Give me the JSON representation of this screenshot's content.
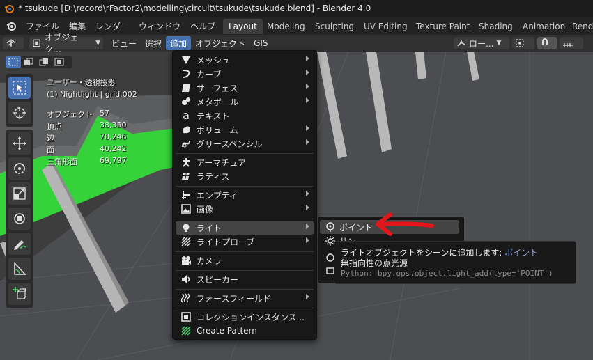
{
  "window": {
    "title": "* tsukude [D:\\record\\rFactor2\\modelling\\circuit\\tsukude\\tsukude.blend] - Blender 4.0"
  },
  "menubar": {
    "items": [
      "ファイル",
      "編集",
      "レンダー",
      "ウィンドウ",
      "ヘルプ"
    ]
  },
  "workspaces": [
    "Layout",
    "Modeling",
    "Sculpting",
    "UV Editing",
    "Texture Paint",
    "Shading",
    "Animation",
    "Rende"
  ],
  "header": {
    "mode_label": "オブジェク...",
    "menus": [
      "ビュー",
      "選択",
      "追加",
      "オブジェクト",
      "GIS"
    ],
    "orientation_label": "ロー..."
  },
  "viewport": {
    "view_name": "ユーザー・透視投影",
    "collection_info": "(1) Nightlight | grid.002",
    "stats": [
      {
        "label": "オブジェクト",
        "value": "57"
      },
      {
        "label": "頂点",
        "value": "38,350"
      },
      {
        "label": "辺",
        "value": "78,246"
      },
      {
        "label": "面",
        "value": "40,242"
      },
      {
        "label": "三角形面",
        "value": "69,797"
      }
    ]
  },
  "add_menu": {
    "items": [
      {
        "label": "メッシュ",
        "icon": "mesh-icon"
      },
      {
        "label": "カーブ",
        "icon": "curve-icon"
      },
      {
        "label": "サーフェス",
        "icon": "surface-icon"
      },
      {
        "label": "メタボール",
        "icon": "metaball-icon"
      },
      {
        "label": "テキスト",
        "icon": "text-icon"
      },
      {
        "label": "ボリューム",
        "icon": "volume-icon"
      },
      {
        "label": "グリースペンシル",
        "icon": "grease-pencil-icon"
      },
      {
        "label": "アーマチュア",
        "icon": "armature-icon"
      },
      {
        "label": "ラティス",
        "icon": "lattice-icon"
      },
      {
        "label": "エンプティ",
        "icon": "empty-icon"
      },
      {
        "label": "画像",
        "icon": "image-icon"
      },
      {
        "label": "ライト",
        "icon": "light-icon"
      },
      {
        "label": "ライトプローブ",
        "icon": "light-probe-icon"
      },
      {
        "label": "カメラ",
        "icon": "camera-icon"
      },
      {
        "label": "スピーカー",
        "icon": "speaker-icon"
      },
      {
        "label": "フォースフィールド",
        "icon": "force-field-icon"
      },
      {
        "label": "コレクションインスタンス...",
        "icon": "collection-icon"
      },
      {
        "label": "Create Pattern",
        "icon": "pattern-icon"
      }
    ]
  },
  "light_submenu": {
    "items": [
      {
        "label": "ポイント",
        "icon": "point-light-icon"
      },
      {
        "label": "サン",
        "icon": "sun-light-icon"
      }
    ]
  },
  "tooltip": {
    "line1_prefix": "ライトオブジェクトをシーンに追加します: ",
    "line1_accent": "ポイント",
    "line2": "無指向性の点光源",
    "python": "Python: bpy.ops.object.light_add(type='POINT')"
  },
  "colors": {
    "accent": "#4772b3",
    "green_ground": "#36d23a",
    "annotation_arrow": "#e0161b"
  }
}
